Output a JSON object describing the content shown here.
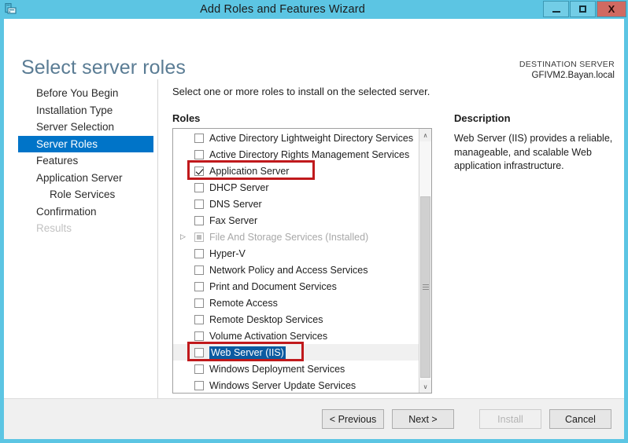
{
  "window": {
    "title": "Add Roles and Features Wizard",
    "app_icon": "server-icon",
    "minimize_label": "–",
    "maximize_label": "□",
    "close_label": "X",
    "titlebar_color": "#5cc5e3"
  },
  "header": {
    "page_title": "Select server roles",
    "destination_label": "DESTINATION SERVER",
    "destination_value": "GFIVM2.Bayan.local"
  },
  "sidebar": {
    "items": [
      {
        "label": "Before You Begin",
        "state": "normal",
        "indent": false
      },
      {
        "label": "Installation Type",
        "state": "normal",
        "indent": false
      },
      {
        "label": "Server Selection",
        "state": "normal",
        "indent": false
      },
      {
        "label": "Server Roles",
        "state": "active",
        "indent": false
      },
      {
        "label": "Features",
        "state": "normal",
        "indent": false
      },
      {
        "label": "Application Server",
        "state": "normal",
        "indent": false
      },
      {
        "label": "Role Services",
        "state": "normal",
        "indent": true
      },
      {
        "label": "Confirmation",
        "state": "normal",
        "indent": false
      },
      {
        "label": "Results",
        "state": "disabled",
        "indent": false
      }
    ],
    "active_color": "#0074c8"
  },
  "main": {
    "instruction": "Select one or more roles to install on the selected server.",
    "roles_heading": "Roles",
    "roles": [
      {
        "label": "Active Directory Lightweight Directory Services",
        "checked": false,
        "partial": false,
        "installed": false,
        "selected": false,
        "expander": false,
        "annotated": false
      },
      {
        "label": "Active Directory Rights Management Services",
        "checked": false,
        "partial": false,
        "installed": false,
        "selected": false,
        "expander": false,
        "annotated": false
      },
      {
        "label": "Application Server",
        "checked": true,
        "partial": false,
        "installed": false,
        "selected": false,
        "expander": false,
        "annotated": true
      },
      {
        "label": "DHCP Server",
        "checked": false,
        "partial": false,
        "installed": false,
        "selected": false,
        "expander": false,
        "annotated": false
      },
      {
        "label": "DNS Server",
        "checked": false,
        "partial": false,
        "installed": false,
        "selected": false,
        "expander": false,
        "annotated": false
      },
      {
        "label": "Fax Server",
        "checked": false,
        "partial": false,
        "installed": false,
        "selected": false,
        "expander": false,
        "annotated": false
      },
      {
        "label": "File And Storage Services (Installed)",
        "checked": false,
        "partial": true,
        "installed": true,
        "selected": false,
        "expander": true,
        "annotated": false
      },
      {
        "label": "Hyper-V",
        "checked": false,
        "partial": false,
        "installed": false,
        "selected": false,
        "expander": false,
        "annotated": false
      },
      {
        "label": "Network Policy and Access Services",
        "checked": false,
        "partial": false,
        "installed": false,
        "selected": false,
        "expander": false,
        "annotated": false
      },
      {
        "label": "Print and Document Services",
        "checked": false,
        "partial": false,
        "installed": false,
        "selected": false,
        "expander": false,
        "annotated": false
      },
      {
        "label": "Remote Access",
        "checked": false,
        "partial": false,
        "installed": false,
        "selected": false,
        "expander": false,
        "annotated": false
      },
      {
        "label": "Remote Desktop Services",
        "checked": false,
        "partial": false,
        "installed": false,
        "selected": false,
        "expander": false,
        "annotated": false
      },
      {
        "label": "Volume Activation Services",
        "checked": false,
        "partial": false,
        "installed": false,
        "selected": false,
        "expander": false,
        "annotated": false
      },
      {
        "label": "Web Server (IIS)",
        "checked": false,
        "partial": false,
        "installed": false,
        "selected": true,
        "expander": false,
        "annotated": true
      },
      {
        "label": "Windows Deployment Services",
        "checked": false,
        "partial": false,
        "installed": false,
        "selected": false,
        "expander": false,
        "annotated": false
      },
      {
        "label": "Windows Server Update Services",
        "checked": false,
        "partial": false,
        "installed": false,
        "selected": false,
        "expander": false,
        "annotated": false
      }
    ],
    "description_heading": "Description",
    "description_text": "Web Server (IIS) provides a reliable, manageable, and scalable Web application infrastructure.",
    "annotation_color": "#c0191c",
    "selection_color": "#0b5ba1",
    "scrollbar": {
      "up_arrow": "∧",
      "down_arrow": "∨"
    }
  },
  "footer": {
    "previous_label": "< Previous",
    "next_label": "Next >",
    "install_label": "Install",
    "install_enabled": false,
    "cancel_label": "Cancel"
  }
}
